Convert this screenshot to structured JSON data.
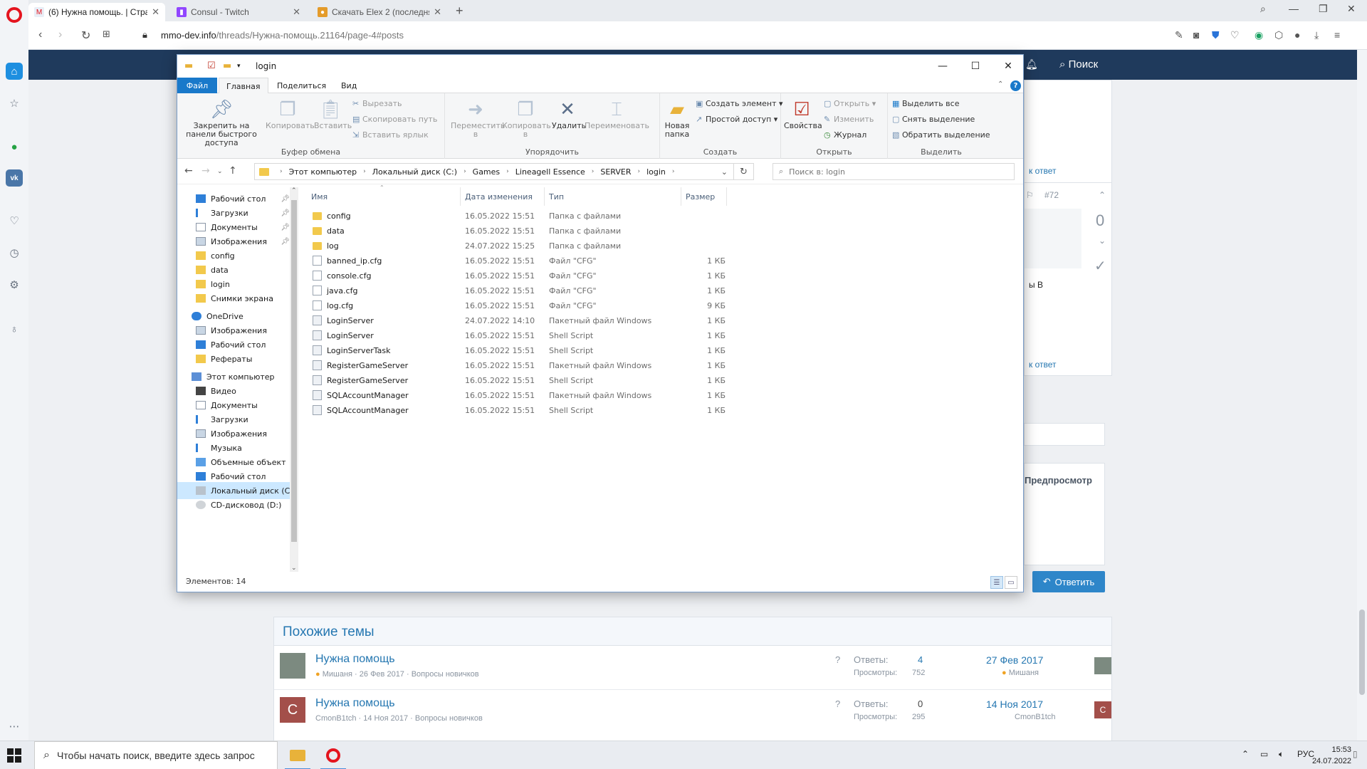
{
  "browser": {
    "tabs": [
      {
        "title": "(6) Нужна помощь. | Стра",
        "active": true
      },
      {
        "title": "Consul - Twitch",
        "active": false
      },
      {
        "title": "Скачать Elex 2 (последняя",
        "active": false
      }
    ],
    "url_host": "mmo-dev.info",
    "url_path": "/threads/Нужна-помощь.21164/page-4#posts"
  },
  "site": {
    "search_label": "Поиск",
    "post_number": "#72",
    "vote_score": "0",
    "reply_link_1": "к ответ",
    "reply_link_2": "к ответ",
    "side_fragment": "ы В",
    "preview_label": "Предпросмотр",
    "reply_button": "Ответить",
    "similar_title": "Похожие темы",
    "similar": [
      {
        "title": "Нужна помощь",
        "author": "Мишаня",
        "date": "26 Фев 2017",
        "forum": "Вопросы новичков",
        "replies_label": "Ответы:",
        "replies": "4",
        "views_label": "Просмотры:",
        "views": "752",
        "last_date": "27 Фев 2017",
        "last_user": "Мишаня",
        "avatar_letter": ""
      },
      {
        "title": "Нужна помощь",
        "author": "CmonB1tch",
        "date": "14 Ноя 2017",
        "forum": "Вопросы новичков",
        "replies_label": "Ответы:",
        "replies": "0",
        "views_label": "Просмотры:",
        "views": "295",
        "last_date": "14 Ноя 2017",
        "last_user": "CmonB1tch",
        "avatar_letter": "C"
      }
    ]
  },
  "explorer": {
    "title": "login",
    "ribbon_tabs": [
      "Файл",
      "Главная",
      "Поделиться",
      "Вид"
    ],
    "clipboard": {
      "pin": "Закрепить на панели быстрого доступа",
      "copy": "Копировать",
      "paste": "Вставить",
      "cut": "Вырезать",
      "copy_path": "Скопировать путь",
      "paste_shortcut": "Вставить ярлык",
      "label": "Буфер обмена"
    },
    "organize": {
      "move": "Переместить в",
      "copy_to": "Копировать в",
      "delete": "Удалить",
      "rename": "Переименовать",
      "label": "Упорядочить"
    },
    "create": {
      "new_folder": "Новая папка",
      "new_item": "Создать элемент",
      "easy_access": "Простой доступ",
      "label": "Создать"
    },
    "open": {
      "properties": "Свойства",
      "open": "Открыть",
      "edit": "Изменить",
      "history": "Журнал",
      "label": "Открыть"
    },
    "select": {
      "select_all": "Выделить все",
      "select_none": "Снять выделение",
      "invert": "Обратить выделение",
      "label": "Выделить"
    },
    "breadcrumbs": [
      "Этот компьютер",
      "Локальный диск (C:)",
      "Games",
      "Lineagell Essence",
      "SERVER",
      "login"
    ],
    "search_placeholder": "Поиск в: login",
    "nav": [
      {
        "label": "Рабочий стол",
        "icon": "desktop",
        "pinned": true
      },
      {
        "label": "Загрузки",
        "icon": "download",
        "pinned": true
      },
      {
        "label": "Документы",
        "icon": "docs",
        "pinned": true
      },
      {
        "label": "Изображения",
        "icon": "images",
        "pinned": true
      },
      {
        "label": "config",
        "icon": "folder",
        "pinned": false
      },
      {
        "label": "data",
        "icon": "folder",
        "pinned": false
      },
      {
        "label": "login",
        "icon": "folder",
        "pinned": false
      },
      {
        "label": "Снимки экрана",
        "icon": "folder",
        "pinned": false
      },
      {
        "label": "OneDrive",
        "icon": "cloud",
        "pinned": false
      },
      {
        "label": "Изображения",
        "icon": "images",
        "pinned": false
      },
      {
        "label": "Рабочий стол",
        "icon": "desktop",
        "pinned": false
      },
      {
        "label": "Рефераты",
        "icon": "folder",
        "pinned": false
      },
      {
        "label": "Этот компьютер",
        "icon": "pc",
        "pinned": false
      },
      {
        "label": "Видео",
        "icon": "video",
        "pinned": false
      },
      {
        "label": "Документы",
        "icon": "docs",
        "pinned": false
      },
      {
        "label": "Загрузки",
        "icon": "download",
        "pinned": false
      },
      {
        "label": "Изображения",
        "icon": "images",
        "pinned": false
      },
      {
        "label": "Музыка",
        "icon": "music",
        "pinned": false
      },
      {
        "label": "Объемные объект",
        "icon": "3d",
        "pinned": false
      },
      {
        "label": "Рабочий стол",
        "icon": "desktop",
        "pinned": false
      },
      {
        "label": "Локальный диск (C",
        "icon": "drive",
        "pinned": false,
        "selected": true
      },
      {
        "label": "CD-дисковод (D:)",
        "icon": "cd",
        "pinned": false
      }
    ],
    "columns": [
      "Имя",
      "Дата изменения",
      "Тип",
      "Размер"
    ],
    "files": [
      {
        "name": "config",
        "date": "16.05.2022 15:51",
        "type": "Папка с файлами",
        "size": "",
        "kind": "folder"
      },
      {
        "name": "data",
        "date": "16.05.2022 15:51",
        "type": "Папка с файлами",
        "size": "",
        "kind": "folder"
      },
      {
        "name": "log",
        "date": "24.07.2022 15:25",
        "type": "Папка с файлами",
        "size": "",
        "kind": "folder"
      },
      {
        "name": "banned_ip.cfg",
        "date": "16.05.2022 15:51",
        "type": "Файл \"CFG\"",
        "size": "1 КБ",
        "kind": "file"
      },
      {
        "name": "console.cfg",
        "date": "16.05.2022 15:51",
        "type": "Файл \"CFG\"",
        "size": "1 КБ",
        "kind": "file"
      },
      {
        "name": "java.cfg",
        "date": "16.05.2022 15:51",
        "type": "Файл \"CFG\"",
        "size": "1 КБ",
        "kind": "file"
      },
      {
        "name": "log.cfg",
        "date": "16.05.2022 15:51",
        "type": "Файл \"CFG\"",
        "size": "9 КБ",
        "kind": "file"
      },
      {
        "name": "LoginServer",
        "date": "24.07.2022 14:10",
        "type": "Пакетный файл Windows",
        "size": "1 КБ",
        "kind": "bat"
      },
      {
        "name": "LoginServer",
        "date": "16.05.2022 15:51",
        "type": "Shell Script",
        "size": "1 КБ",
        "kind": "bat"
      },
      {
        "name": "LoginServerTask",
        "date": "16.05.2022 15:51",
        "type": "Shell Script",
        "size": "1 КБ",
        "kind": "bat"
      },
      {
        "name": "RegisterGameServer",
        "date": "16.05.2022 15:51",
        "type": "Пакетный файл Windows",
        "size": "1 КБ",
        "kind": "bat"
      },
      {
        "name": "RegisterGameServer",
        "date": "16.05.2022 15:51",
        "type": "Shell Script",
        "size": "1 КБ",
        "kind": "bat"
      },
      {
        "name": "SQLAccountManager",
        "date": "16.05.2022 15:51",
        "type": "Пакетный файл Windows",
        "size": "1 КБ",
        "kind": "bat"
      },
      {
        "name": "SQLAccountManager",
        "date": "16.05.2022 15:51",
        "type": "Shell Script",
        "size": "1 КБ",
        "kind": "bat"
      }
    ],
    "status": "Элементов: 14"
  },
  "taskbar": {
    "search_placeholder": "Чтобы начать поиск, введите здесь запрос",
    "lang": "РУС",
    "time": "15:53",
    "date": "24.07.2022"
  },
  "colors": {
    "accent": "#1979ca",
    "site_header": "#1f3a5c",
    "link": "#2577b1",
    "opera": "#e4141e"
  }
}
